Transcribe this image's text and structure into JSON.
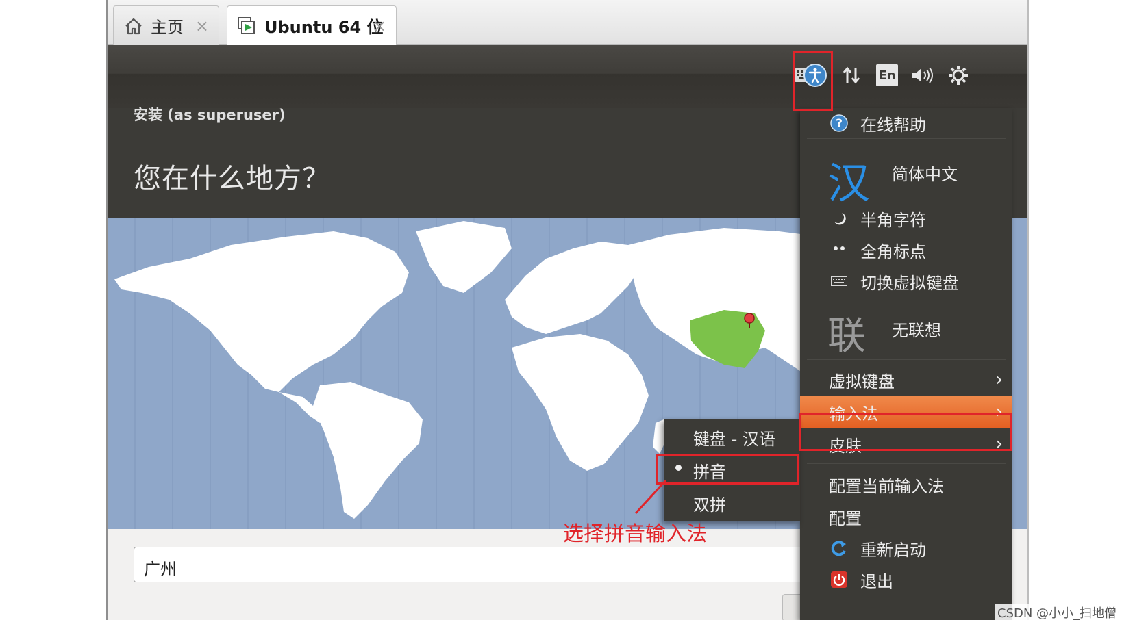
{
  "tabs": [
    {
      "label": "主页",
      "icon": "home-icon"
    },
    {
      "label": "Ubuntu 64 位",
      "icon": "vm-play-icon"
    }
  ],
  "tab_close_glyph": "×",
  "panel": {
    "indicators": [
      "keyboard-icon",
      "accessibility-icon",
      "network-icon",
      "language-icon",
      "volume-icon",
      "settings-gear-icon"
    ],
    "language_label": "En"
  },
  "installer": {
    "subtitle": "安装 (as superuser)",
    "title": "您在什么地方？",
    "city_value": "广州"
  },
  "menu": {
    "online_help": "在线帮助",
    "im_glyph": "汉",
    "im_name": "简体中文",
    "half_width": "半角字符",
    "full_punct": "全角标点",
    "toggle_vkbd": "切换虚拟键盘",
    "lian_glyph": "联",
    "no_predict": "无联想",
    "virtual_keyboard": "虚拟键盘",
    "input_method": "输入法",
    "skin": "皮肤",
    "configure_current": "配置当前输入法",
    "configure": "配置",
    "restart": "重新启动",
    "exit": "退出",
    "arrow": "›"
  },
  "submenu": {
    "items": [
      "键盘 - 汉语",
      "拼音",
      "双拼"
    ],
    "selected": "拼音"
  },
  "annotation": "选择拼音输入法",
  "watermark": "CSDN @小小_扫地僧",
  "colors": {
    "highlight_border": "#e0242a",
    "menu_bg": "#3b3a36",
    "menu_active": "#e96c31",
    "map_ocean": "#8fa7c9",
    "map_land": "#ffffff",
    "china_selected": "#7cc24a"
  }
}
